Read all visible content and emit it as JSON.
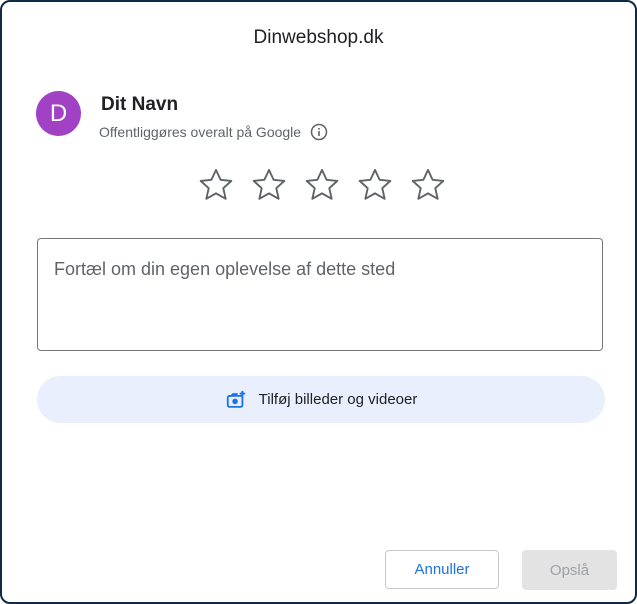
{
  "dialog": {
    "title": "Dinwebshop.dk"
  },
  "user": {
    "initial": "D",
    "name": "Dit Navn",
    "visibility_note": "Offentliggøres overalt på Google",
    "avatar_color": "#a142c4"
  },
  "rating": {
    "max_stars": 5,
    "selected": 0
  },
  "review": {
    "placeholder": "Fortæl om din egen oplevelse af dette sted",
    "value": ""
  },
  "media": {
    "label": "Tilføj billeder og videoer",
    "icon": "add-photo-icon"
  },
  "actions": {
    "cancel_label": "Annuller",
    "post_label": "Opslå"
  },
  "colors": {
    "accent": "#1a73e8",
    "media_bg": "#e9effc",
    "border": "#0e2a47"
  }
}
